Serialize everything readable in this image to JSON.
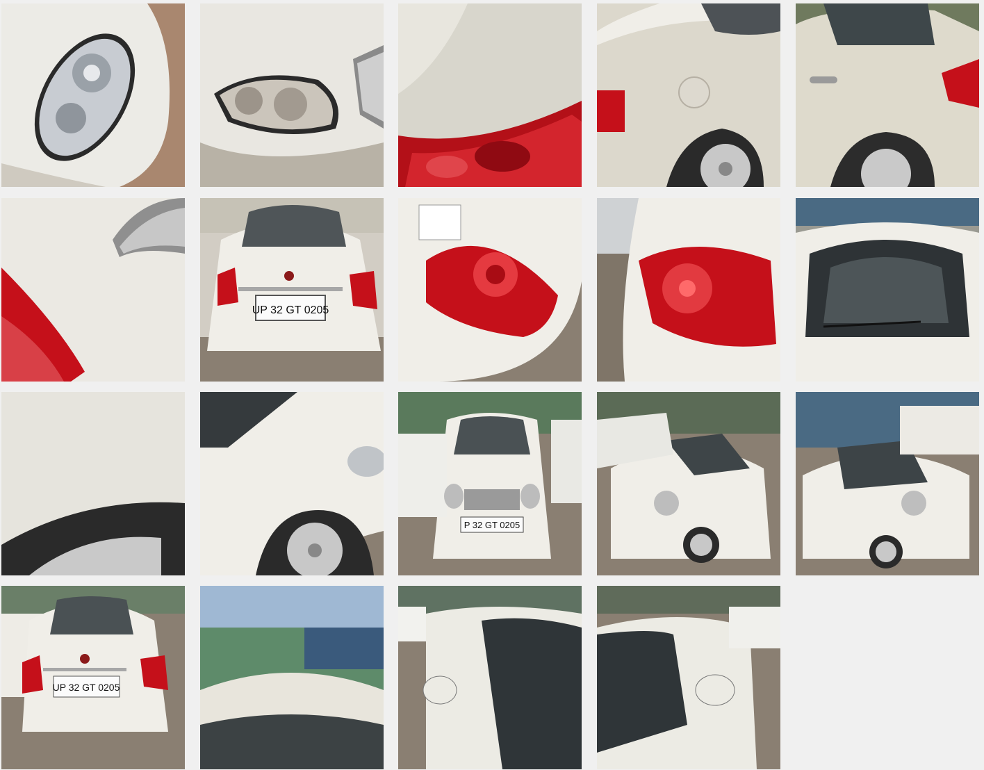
{
  "gallery": {
    "photos": [
      {
        "subject": "front-headlight-left-closeup",
        "plate_text": ""
      },
      {
        "subject": "front-headlight-right",
        "plate_text": ""
      },
      {
        "subject": "tail-light-top-closeup",
        "plate_text": ""
      },
      {
        "subject": "rear-side-fuel-lid",
        "plate_text": ""
      },
      {
        "subject": "rear-door-side",
        "plate_text": ""
      },
      {
        "subject": "tail-light-edge-closeup",
        "plate_text": ""
      },
      {
        "subject": "rear-view",
        "plate_text": "UP 32 GT 0205"
      },
      {
        "subject": "tail-light-left",
        "plate_text": ""
      },
      {
        "subject": "tail-light-right",
        "plate_text": ""
      },
      {
        "subject": "windshield-front-top",
        "plate_text": ""
      },
      {
        "subject": "rear-wheel-arch-closeup",
        "plate_text": ""
      },
      {
        "subject": "front-wheel-side",
        "plate_text": ""
      },
      {
        "subject": "front-view",
        "plate_text": "P 32 GT 0205"
      },
      {
        "subject": "front-three-quarter-left",
        "plate_text": ""
      },
      {
        "subject": "front-three-quarter-right",
        "plate_text": ""
      },
      {
        "subject": "rear-view-wide",
        "plate_text": "UP 32 GT 0205"
      },
      {
        "subject": "roof-and-windshield",
        "plate_text": ""
      },
      {
        "subject": "side-mirror-driver",
        "plate_text": ""
      },
      {
        "subject": "side-mirror-passenger",
        "plate_text": ""
      }
    ]
  },
  "colors": {
    "background": "#f0f0f0",
    "car_white": "#eeeae0",
    "tail_light_red": "#c5101a",
    "paving": "#8a7f72"
  }
}
